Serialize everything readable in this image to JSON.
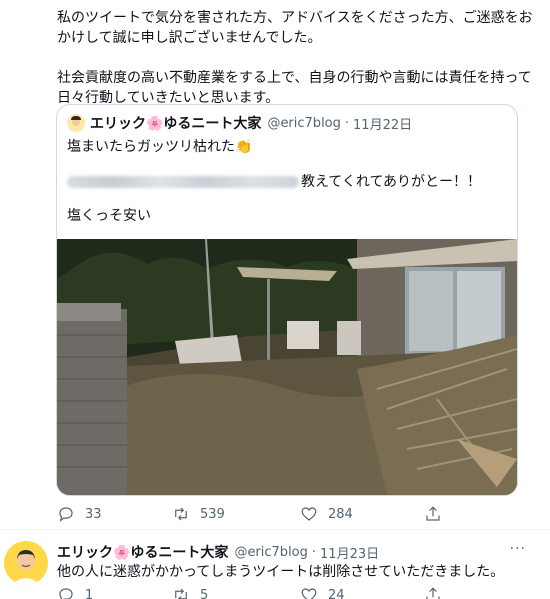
{
  "tweet": {
    "paragraph1": "私のツイートで気分を害された方、アドバイスをくださった方、ご迷惑をおかけして誠に申し訳ございませんでした。",
    "paragraph2": "社会貢献度の高い不動産業をする上で、自身の行動や言動には責任を持って日々行動していきたいと思います。"
  },
  "quote": {
    "author_name": "エリック🌸ゆるニート大家",
    "handle": "@eric7blog",
    "separator": "·",
    "date": "11月22日",
    "line1": "塩まいたらガッツリ枯れた👏",
    "line2_suffix": "教えてくれてありがとー！！",
    "line3": "塩くっそ安い"
  },
  "actions": {
    "replies": "33",
    "retweets": "539",
    "likes": "284"
  },
  "reply": {
    "author_name": "エリック🌸ゆるニート大家",
    "handle": "@eric7blog",
    "separator": "·",
    "date": "11月23日",
    "text": "他の人に迷惑がかかってしまうツイートは削除させていただきました。",
    "more": "···",
    "replies": "1",
    "retweets": "5",
    "likes": "24"
  },
  "icons": [
    "reply-icon",
    "retweet-icon",
    "like-icon",
    "share-icon",
    "more-icon",
    "avatar"
  ]
}
